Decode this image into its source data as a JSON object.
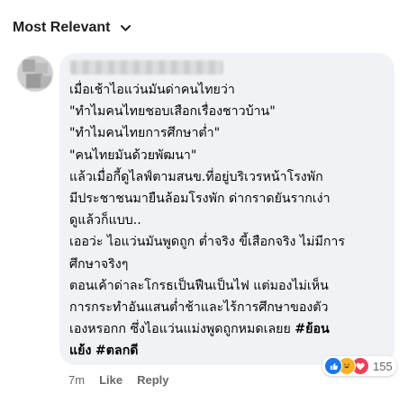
{
  "sort": {
    "label": "Most Relevant"
  },
  "comment": {
    "author_redacted": true,
    "lines": [
      "เมื่อเช้าไอแว่นมันด่าคนไทยว่า",
      "\"ทำไมคนไทยชอบเสือกเรื่องชาวบ้าน\"",
      "\"ทำไมคนไทยการศึกษาต่ำ\"",
      "\"คนไทยมันด้วยพัฒนา\"",
      "แล้วเมื่อกี้ดูไลฟ์ตามสนข.ที่อยู่บริเวรหน้าโรงพัก",
      "มีประชาชนมายืนล้อมโรงพัก ด่ากราดยันรากเง่า",
      "ดูแล้วก็แบบ..",
      "เออว่ะ ไอแว่นมันพูดถูก ต่ำจริง ขี้เสือกจริง ไม่มีการ",
      "ศึกษาจริงๆ",
      "ตอนเค้าด่าละโกรธเป็นฟืนเป็นไฟ แต่มองไม่เห็น",
      "การกระทำอันแสนต่ำช้าและไร้การศึกษาของตัว"
    ],
    "line_12_text": "เองหรอกก ซึ่งไอแว่นแม่งพูดถูกหมดเลยย",
    "hashtag_1": "#ย้อน",
    "line_13_text": "แย้ง",
    "hashtag_2": "#ตลกดี",
    "time": "7m",
    "like_label": "Like",
    "reply_label": "Reply",
    "reaction_count": "155",
    "reactions": [
      "like",
      "haha",
      "love"
    ]
  },
  "colors": {
    "bubble": "#f0f2f5",
    "meta_text": "#65676b",
    "like": "#1877f2",
    "haha": "#f7b125",
    "love": "#f33e58"
  }
}
